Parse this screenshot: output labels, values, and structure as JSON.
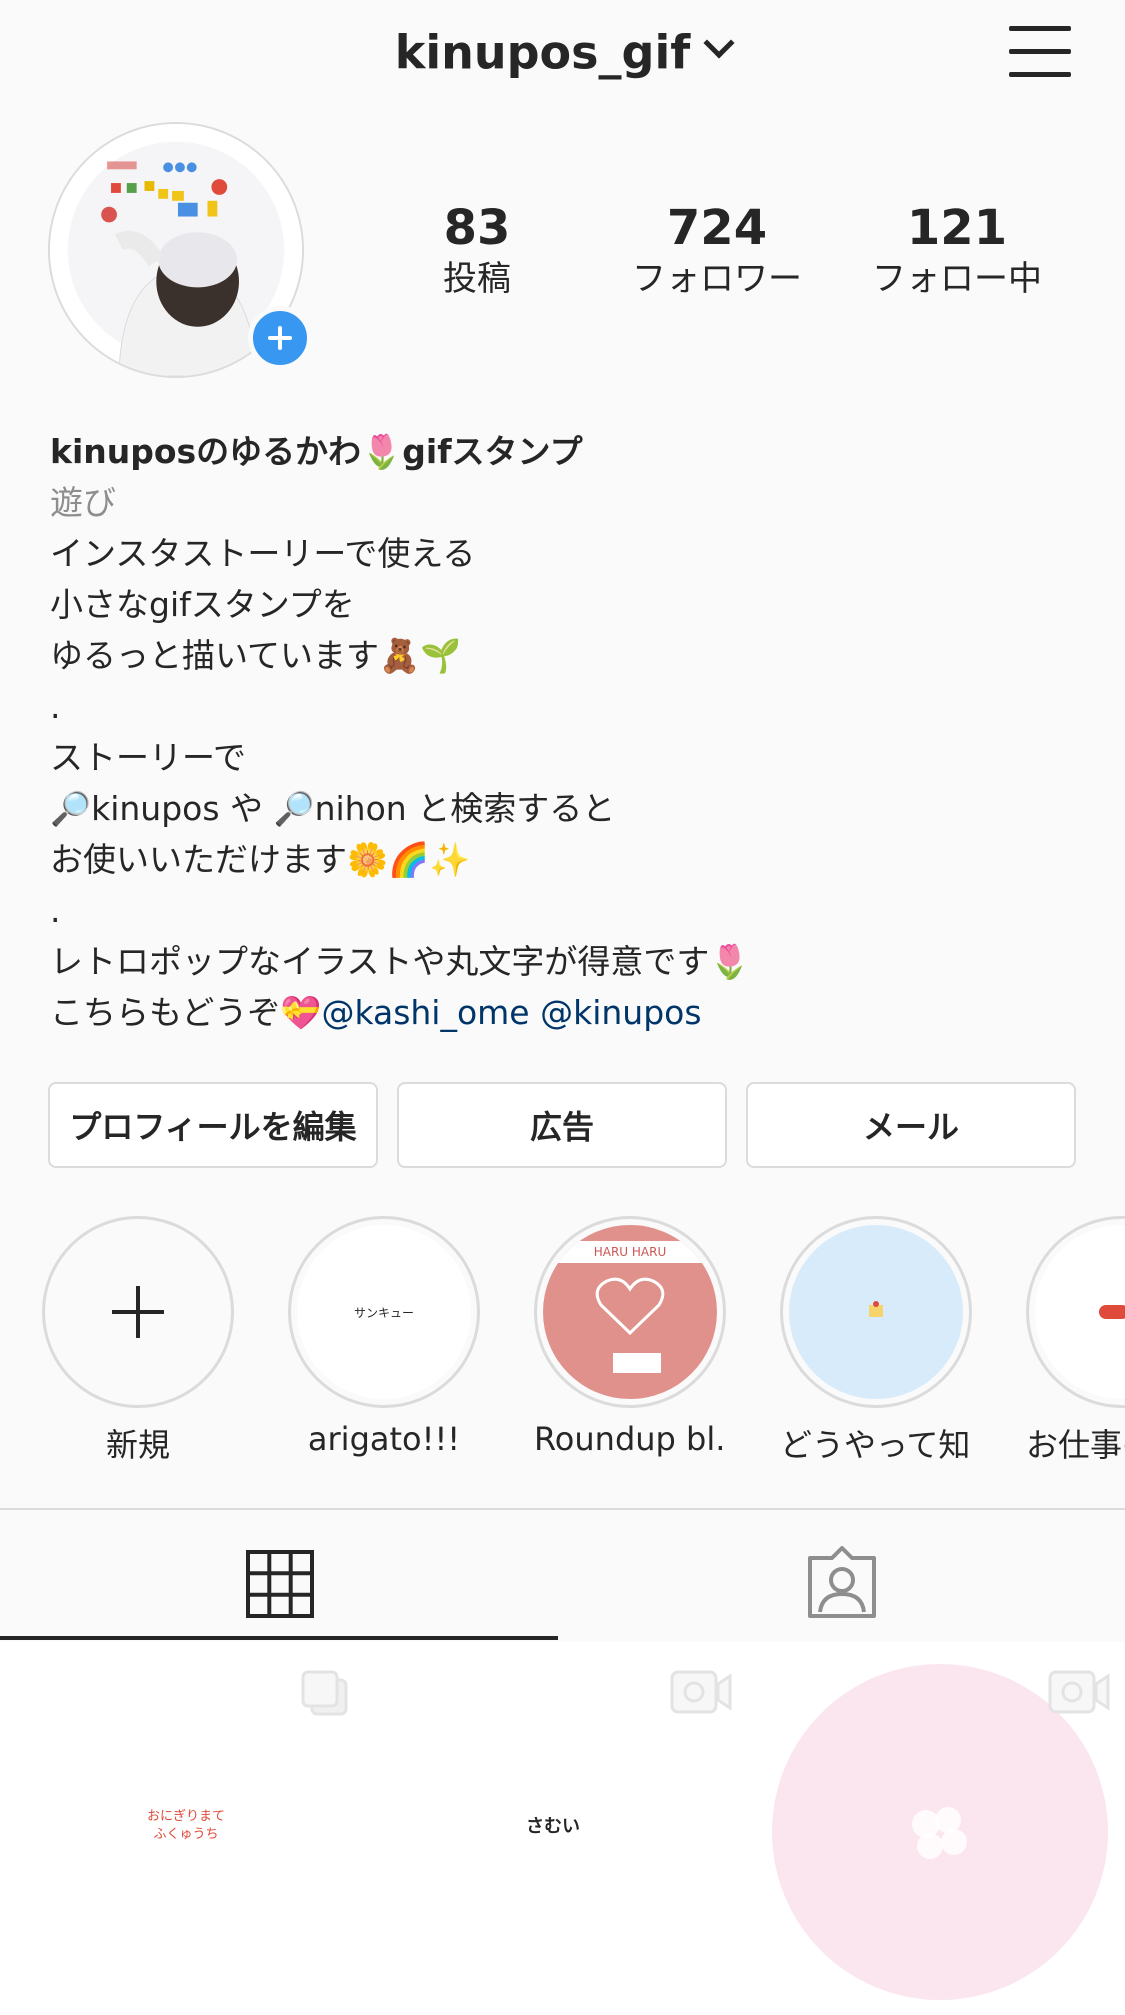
{
  "header": {
    "username": "kinupos_gif",
    "dropdown_icon": "chevron-down-icon",
    "menu_icon": "hamburger-menu-icon"
  },
  "stats": {
    "posts": {
      "value": "83",
      "label": "投稿"
    },
    "followers": {
      "value": "724",
      "label": "フォロワー"
    },
    "following": {
      "value": "121",
      "label": "フォロー中"
    }
  },
  "bio": {
    "name": "kinuposのゆるかわ🌷gifスタンプ",
    "category": "遊び",
    "lines": [
      "インスタストーリーで使える",
      "小さなgifスタンプを",
      "ゆるっと描いています🧸🌱",
      ".",
      "ストーリーで",
      "🔎kinupos や 🔎nihon と検索すると",
      "お使いいただけます🌼🌈✨",
      ".",
      "レトロポップなイラストや丸文字が得意です🌷"
    ],
    "last_line_prefix": "こちらもどうぞ💝",
    "link1": "@kashi_ome",
    "link2": "@kinupos"
  },
  "buttons": {
    "edit_profile": "プロフィールを編集",
    "ads": "広告",
    "email": "メール"
  },
  "highlights": [
    {
      "label": "新規"
    },
    {
      "label": "arigato!!!",
      "thumb_text": "サンキュー"
    },
    {
      "label": "Roundup bl...",
      "thumb_text": "HARU HARU"
    },
    {
      "label": "どうやって知…"
    },
    {
      "label": "お仕事の"
    }
  ],
  "tabs": {
    "grid_icon": "grid-icon",
    "tagged_icon": "tagged-person-icon"
  },
  "grid_posts": [
    {
      "type_icon": "carousel-icon",
      "thumb_text": "おにぎりまて ふくゅうち"
    },
    {
      "type_icon": "video-icon",
      "thumb_text": "さむい"
    },
    {
      "type_icon": "video-icon"
    }
  ],
  "colors": {
    "accent_blue": "#3897f0",
    "link": "#003569",
    "border": "#dbdbdb",
    "text": "#262626",
    "muted": "#8e8e8e"
  }
}
